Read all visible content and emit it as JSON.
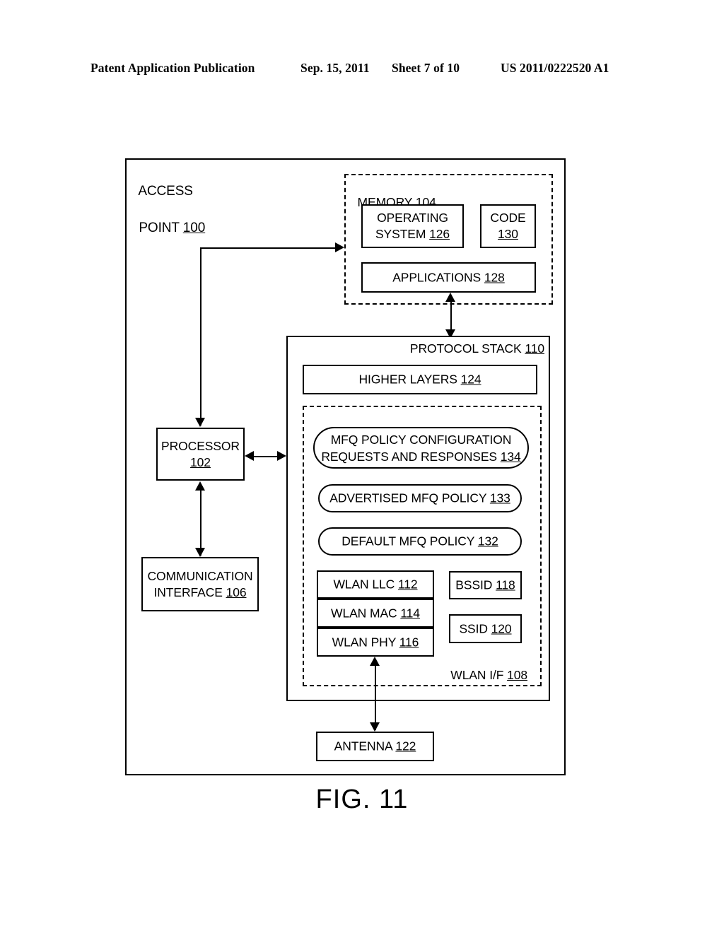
{
  "header": {
    "publication": "Patent Application Publication",
    "date": "Sep. 15, 2011",
    "sheet": "Sheet 7 of 10",
    "patent_number": "US 2011/0222520 A1"
  },
  "figure": {
    "caption": "FIG. 11",
    "outer_label_line1": "ACCESS",
    "outer_label_line2": "POINT",
    "outer_ref": "100"
  },
  "memory": {
    "label": "MEMORY",
    "ref": "104",
    "operating_system": {
      "line1": "OPERATING",
      "line2": "SYSTEM",
      "ref": "126"
    },
    "code": {
      "line1": "CODE",
      "ref": "130"
    },
    "applications": {
      "label": "APPLICATIONS",
      "ref": "128"
    }
  },
  "processor": {
    "line1": "PROCESSOR",
    "ref": "102"
  },
  "communication_interface": {
    "line1": "COMMUNICATION",
    "line2": "INTERFACE",
    "ref": "106"
  },
  "protocol_stack": {
    "label": "PROTOCOL STACK",
    "ref": "110",
    "higher_layers": {
      "label": "HIGHER LAYERS",
      "ref": "124"
    }
  },
  "wlan_if": {
    "label": "WLAN I/F",
    "ref": "108",
    "mfq_requests": {
      "line1": "MFQ POLICY CONFIGURATION",
      "line2": "REQUESTS AND RESPONSES",
      "ref": "134"
    },
    "advertised_policy": {
      "label": "ADVERTISED MFQ POLICY",
      "ref": "133"
    },
    "default_policy": {
      "label": "DEFAULT MFQ POLICY",
      "ref": "132"
    },
    "wlan_llc": {
      "label": "WLAN LLC",
      "ref": "112"
    },
    "wlan_mac": {
      "label": "WLAN MAC",
      "ref": "114"
    },
    "wlan_phy": {
      "label": "WLAN PHY",
      "ref": "116"
    },
    "bssid": {
      "label": "BSSID",
      "ref": "118"
    },
    "ssid": {
      "label": "SSID",
      "ref": "120"
    }
  },
  "antenna": {
    "label": "ANTENNA",
    "ref": "122"
  }
}
